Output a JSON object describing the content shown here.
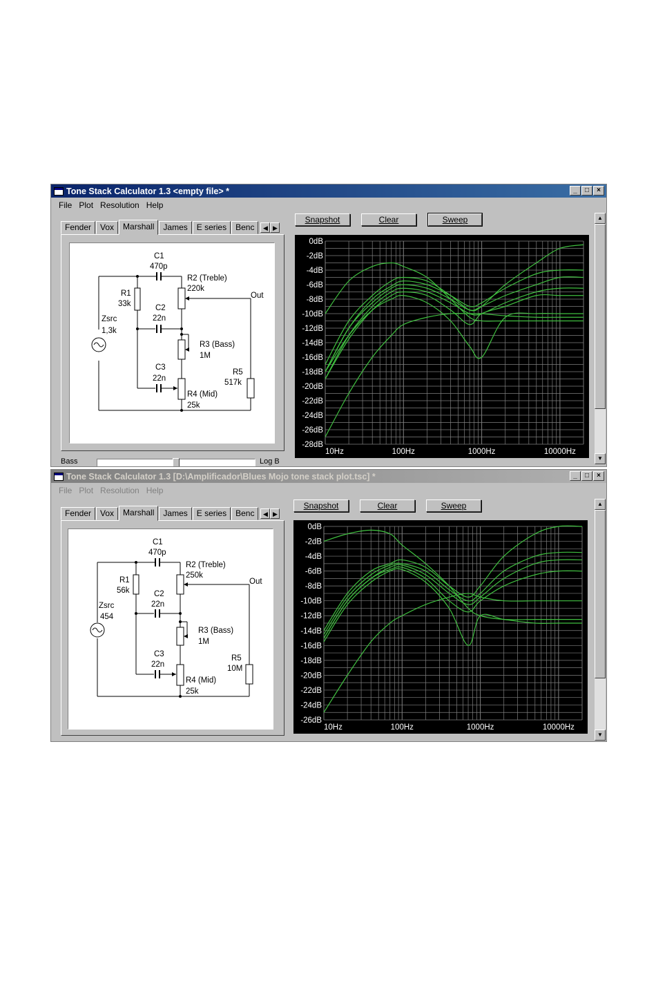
{
  "windows": [
    {
      "title": "Tone Stack Calculator 1.3 <empty file> *",
      "active": true,
      "menu": [
        "File",
        "Plot",
        "Resolution",
        "Help"
      ],
      "tabs": [
        "Fender",
        "Vox",
        "Marshall",
        "James",
        "E series",
        "Benc"
      ],
      "selected_tab": "Marshall",
      "buttons": {
        "snapshot": "Snapshot",
        "clear": "Clear",
        "sweep": "Sweep"
      },
      "components": {
        "c1_name": "C1",
        "c1_value": "470p",
        "r2_name": "R2 (Treble)",
        "r2_value": "220k",
        "r1_name": "R1",
        "r1_value": "33k",
        "c2_name": "C2",
        "c2_value": "22n",
        "zsrc_name": "Zsrc",
        "zsrc_value": "1,3k",
        "out_label": "Out",
        "r3_name": "R3 (Bass)",
        "r3_value": "1M",
        "c3_name": "C3",
        "c3_value": "22n",
        "r5_name": "R5",
        "r5_value": "517k",
        "r4_name": "R4 (Mid)",
        "r4_value": "25k"
      },
      "slider": {
        "left_label": "Bass",
        "right_label": "Log B",
        "position": 0.5
      },
      "plot": {
        "y_labels": [
          "0dB",
          "-2dB",
          "-4dB",
          "-6dB",
          "-8dB",
          "-10dB",
          "-12dB",
          "-14dB",
          "-16dB",
          "-18dB",
          "-20dB",
          "-22dB",
          "-24dB",
          "-26dB",
          "-28dB"
        ],
        "x_labels": [
          "10Hz",
          "100Hz",
          "1000Hz",
          "10000Hz"
        ]
      }
    },
    {
      "title": "Tone Stack Calculator 1.3 [D:\\Amplificador\\Blues Mojo tone stack plot.tsc] *",
      "active": false,
      "menu": [
        "File",
        "Plot",
        "Resolution",
        "Help"
      ],
      "tabs": [
        "Fender",
        "Vox",
        "Marshall",
        "James",
        "E series",
        "Benc"
      ],
      "selected_tab": "Marshall",
      "buttons": {
        "snapshot": "Snapshot",
        "clear": "Clear",
        "sweep": "Sweep"
      },
      "components": {
        "c1_name": "C1",
        "c1_value": "470p",
        "r2_name": "R2 (Treble)",
        "r2_value": "250k",
        "r1_name": "R1",
        "r1_value": "56k",
        "c2_name": "C2",
        "c2_value": "22n",
        "zsrc_name": "Zsrc",
        "zsrc_value": "454",
        "out_label": "Out",
        "r3_name": "R3 (Bass)",
        "r3_value": "1M",
        "c3_name": "C3",
        "c3_value": "22n",
        "r5_name": "R5",
        "r5_value": "10M",
        "r4_name": "R4 (Mid)",
        "r4_value": "25k"
      },
      "plot": {
        "y_labels": [
          "0dB",
          "-2dB",
          "-4dB",
          "-6dB",
          "-8dB",
          "-10dB",
          "-12dB",
          "-14dB",
          "-16dB",
          "-18dB",
          "-20dB",
          "-22dB",
          "-24dB",
          "-26dB"
        ],
        "x_labels": [
          "10Hz",
          "100Hz",
          "1000Hz",
          "10000Hz"
        ]
      }
    }
  ],
  "chart_data": [
    {
      "type": "line",
      "x_scale": "log",
      "xlabel": "",
      "ylabel": "",
      "xlim": [
        10,
        20000
      ],
      "ylim": [
        -28,
        0
      ],
      "grid": true,
      "colors": {
        "background": "#000000",
        "grid": "#808080",
        "curve": "#40c040",
        "label": "#ffffff"
      },
      "series": [
        {
          "x": [
            10,
            20,
            40,
            70,
            100,
            200,
            400,
            700,
            1000,
            2000,
            5000,
            10000,
            20000
          ],
          "y": [
            -10,
            -5.5,
            -3.5,
            -3,
            -3.5,
            -5,
            -8,
            -10.5,
            -11,
            -11,
            -11,
            -11,
            -11
          ]
        },
        {
          "x": [
            10,
            20,
            40,
            70,
            100,
            200,
            400,
            700,
            1000,
            2000,
            5000,
            10000,
            20000
          ],
          "y": [
            -17,
            -11,
            -7.5,
            -5.5,
            -5,
            -5.5,
            -7.5,
            -9.5,
            -9,
            -6,
            -3,
            -1,
            -0.5
          ]
        },
        {
          "x": [
            10,
            20,
            40,
            70,
            100,
            200,
            400,
            700,
            1000,
            2000,
            5000,
            10000,
            20000
          ],
          "y": [
            -18,
            -12,
            -8,
            -6.2,
            -5.5,
            -6,
            -7.5,
            -9,
            -8.5,
            -6.5,
            -4.5,
            -4,
            -4
          ]
        },
        {
          "x": [
            10,
            20,
            40,
            70,
            100,
            200,
            400,
            700,
            1000,
            2000,
            5000,
            10000,
            20000
          ],
          "y": [
            -18,
            -12,
            -8.5,
            -6.5,
            -6,
            -6.5,
            -8,
            -9.5,
            -9,
            -7.5,
            -6,
            -5,
            -5
          ]
        },
        {
          "x": [
            10,
            20,
            40,
            70,
            100,
            200,
            400,
            700,
            1000,
            2000,
            5000,
            10000,
            20000
          ],
          "y": [
            -19,
            -13,
            -9,
            -7,
            -6.5,
            -7,
            -8.5,
            -10,
            -10,
            -8.5,
            -7,
            -6.5,
            -6.5
          ]
        },
        {
          "x": [
            10,
            20,
            40,
            70,
            100,
            200,
            400,
            700,
            1000,
            2000,
            5000,
            10000,
            20000
          ],
          "y": [
            -19,
            -13.5,
            -9.5,
            -7.5,
            -7,
            -7.5,
            -9.5,
            -11.5,
            -10,
            -9,
            -7.5,
            -7.5,
            -7.5
          ]
        },
        {
          "x": [
            10,
            20,
            40,
            70,
            100,
            200,
            400,
            700,
            1000,
            2000,
            5000,
            10000,
            20000
          ],
          "y": [
            -18,
            -13,
            -9.5,
            -8,
            -7.5,
            -8.5,
            -11,
            -14.5,
            -16,
            -10.5,
            -10,
            -10,
            -10
          ]
        },
        {
          "x": [
            10,
            20,
            40,
            70,
            100,
            200,
            400,
            700,
            1000,
            2000,
            5000,
            10000,
            20000
          ],
          "y": [
            -27,
            -21,
            -16,
            -13,
            -11.5,
            -10.5,
            -10,
            -10,
            -10,
            -10.3,
            -10.5,
            -10.5,
            -10.5
          ]
        }
      ]
    },
    {
      "type": "line",
      "x_scale": "log",
      "xlabel": "",
      "ylabel": "",
      "xlim": [
        10,
        20000
      ],
      "ylim": [
        -26,
        0
      ],
      "grid": true,
      "colors": {
        "background": "#000000",
        "grid": "#808080",
        "curve": "#40c040",
        "label": "#ffffff"
      },
      "series": [
        {
          "x": [
            10,
            20,
            40,
            70,
            100,
            200,
            400,
            700,
            1000,
            2000,
            5000,
            10000,
            20000
          ],
          "y": [
            -2,
            -1,
            -0.5,
            -1,
            -2.5,
            -5,
            -8,
            -11,
            -12,
            -12.5,
            -12.5,
            -12.5,
            -12.5
          ]
        },
        {
          "x": [
            10,
            20,
            40,
            70,
            100,
            200,
            400,
            700,
            1000,
            2000,
            5000,
            10000,
            20000
          ],
          "y": [
            -14,
            -9,
            -6,
            -5,
            -4.5,
            -5.5,
            -8,
            -9.5,
            -8,
            -4,
            -1,
            0,
            0
          ]
        },
        {
          "x": [
            10,
            20,
            40,
            70,
            100,
            200,
            400,
            700,
            1000,
            2000,
            5000,
            10000,
            20000
          ],
          "y": [
            -14.5,
            -9.5,
            -6.5,
            -5.2,
            -5,
            -6,
            -8.5,
            -10,
            -9,
            -6,
            -4,
            -3.5,
            -3.5
          ]
        },
        {
          "x": [
            10,
            20,
            40,
            70,
            100,
            200,
            400,
            700,
            1000,
            2000,
            5000,
            10000,
            20000
          ],
          "y": [
            -15,
            -10,
            -7,
            -5.5,
            -5.2,
            -6.5,
            -9,
            -10.5,
            -9.5,
            -7,
            -5,
            -4.5,
            -4.5
          ]
        },
        {
          "x": [
            10,
            20,
            40,
            70,
            100,
            200,
            400,
            700,
            1000,
            2000,
            5000,
            10000,
            20000
          ],
          "y": [
            -15,
            -10,
            -7,
            -5.8,
            -5.5,
            -7,
            -10,
            -11.5,
            -10,
            -8,
            -6.5,
            -6,
            -6
          ]
        },
        {
          "x": [
            10,
            20,
            40,
            70,
            100,
            200,
            400,
            700,
            1000,
            2000,
            5000,
            10000,
            20000
          ],
          "y": [
            -15.5,
            -10.5,
            -7.5,
            -6,
            -5.8,
            -7.5,
            -11,
            -16,
            -12,
            -12.5,
            -13,
            -13,
            -13
          ]
        },
        {
          "x": [
            10,
            20,
            40,
            70,
            100,
            200,
            400,
            700,
            1000,
            2000,
            5000,
            10000,
            20000
          ],
          "y": [
            -25,
            -20,
            -15.5,
            -13,
            -12,
            -10.5,
            -9.5,
            -9,
            -9.5,
            -10,
            -10,
            -10,
            -10
          ]
        }
      ]
    }
  ]
}
